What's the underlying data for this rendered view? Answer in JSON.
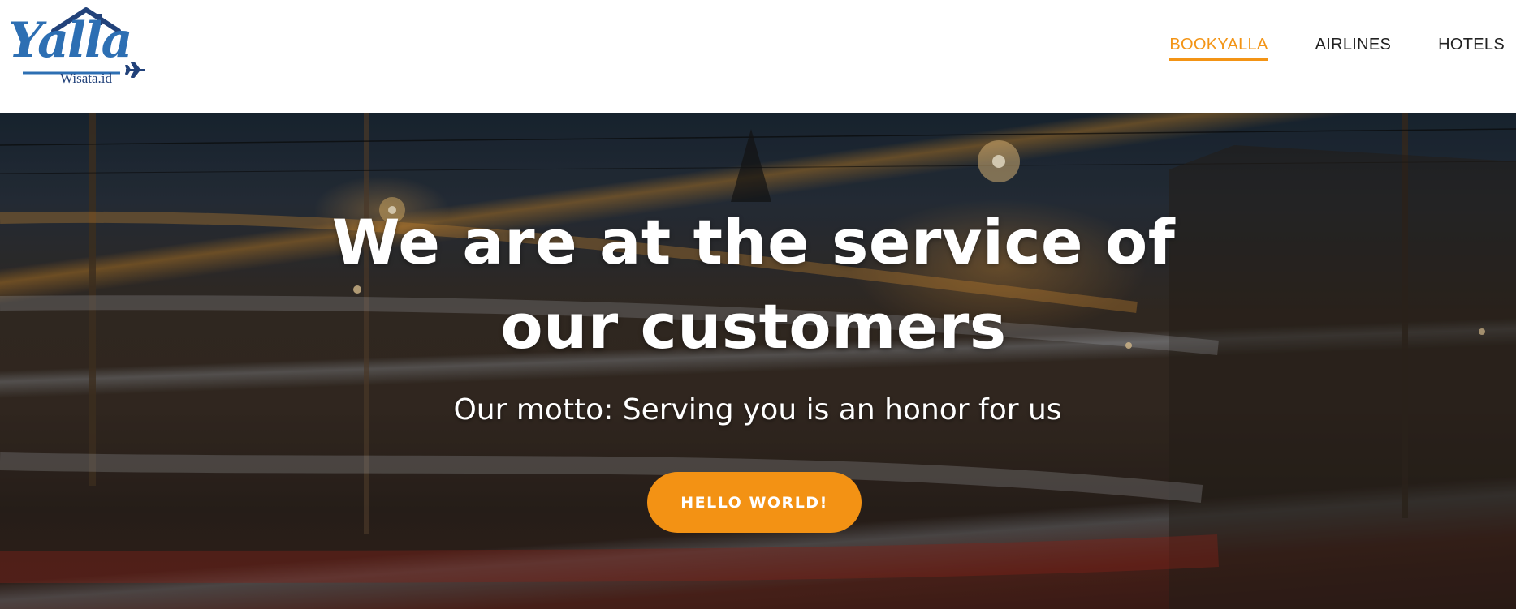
{
  "brand": {
    "name": "Yalla",
    "subtitle": "Wisata.id",
    "icons": [
      "house-roof-icon",
      "airplane-icon"
    ],
    "colors": {
      "primary": "#2d6fb3",
      "dark": "#22427a"
    }
  },
  "nav": {
    "items": [
      {
        "label": "BOOKYALLA",
        "active": true
      },
      {
        "label": "AIRLINES",
        "active": false
      },
      {
        "label": "HOTELS",
        "active": false
      }
    ],
    "active_color": "#f39415"
  },
  "hero": {
    "title": "We are at the service of our customers",
    "subtitle": "Our motto: Serving you is an honor for us",
    "button_label": "HELLO WORLD!",
    "button_color": "#f39214"
  }
}
